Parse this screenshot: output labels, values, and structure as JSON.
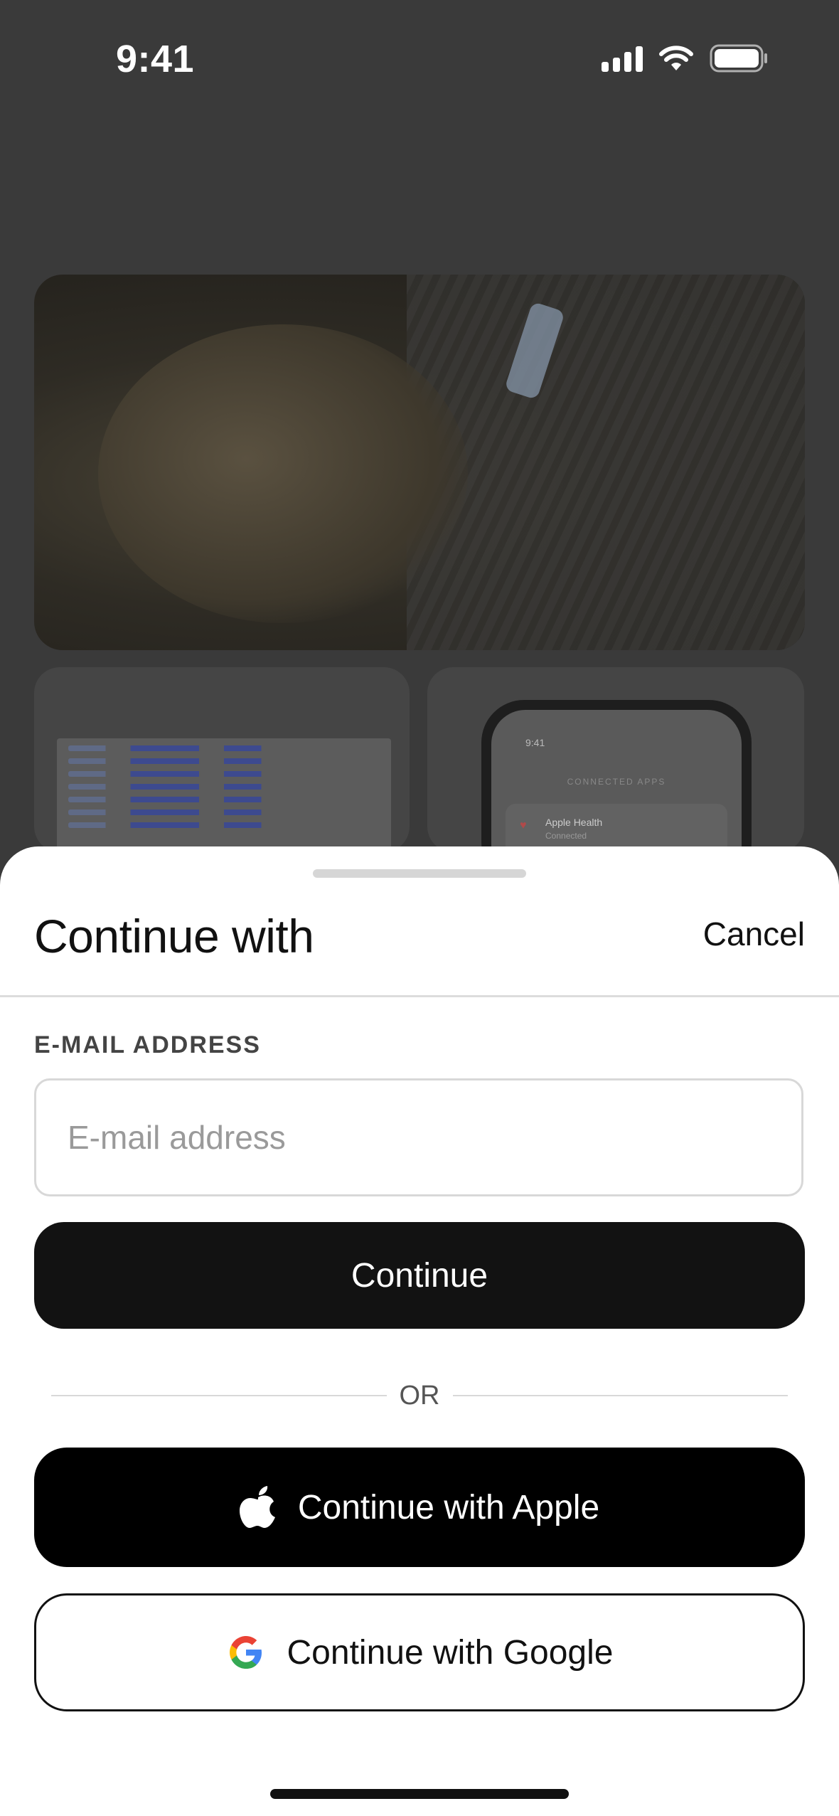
{
  "status_bar": {
    "time": "9:41"
  },
  "background": {
    "mini_phone": {
      "time": "9:41",
      "header": "CONNECTED APPS",
      "item_name": "Apple Health",
      "item_status": "Connected"
    }
  },
  "sheet": {
    "title": "Continue with",
    "cancel_label": "Cancel",
    "email_label": "E-MAIL ADDRESS",
    "email_placeholder": "E-mail address",
    "email_value": "",
    "continue_label": "Continue",
    "or_label": "OR",
    "apple_label": "Continue with Apple",
    "google_label": "Continue with Google"
  },
  "colors": {
    "primary_button": "#121212",
    "apple_button": "#000000",
    "overlay": "#3a3a3a"
  }
}
